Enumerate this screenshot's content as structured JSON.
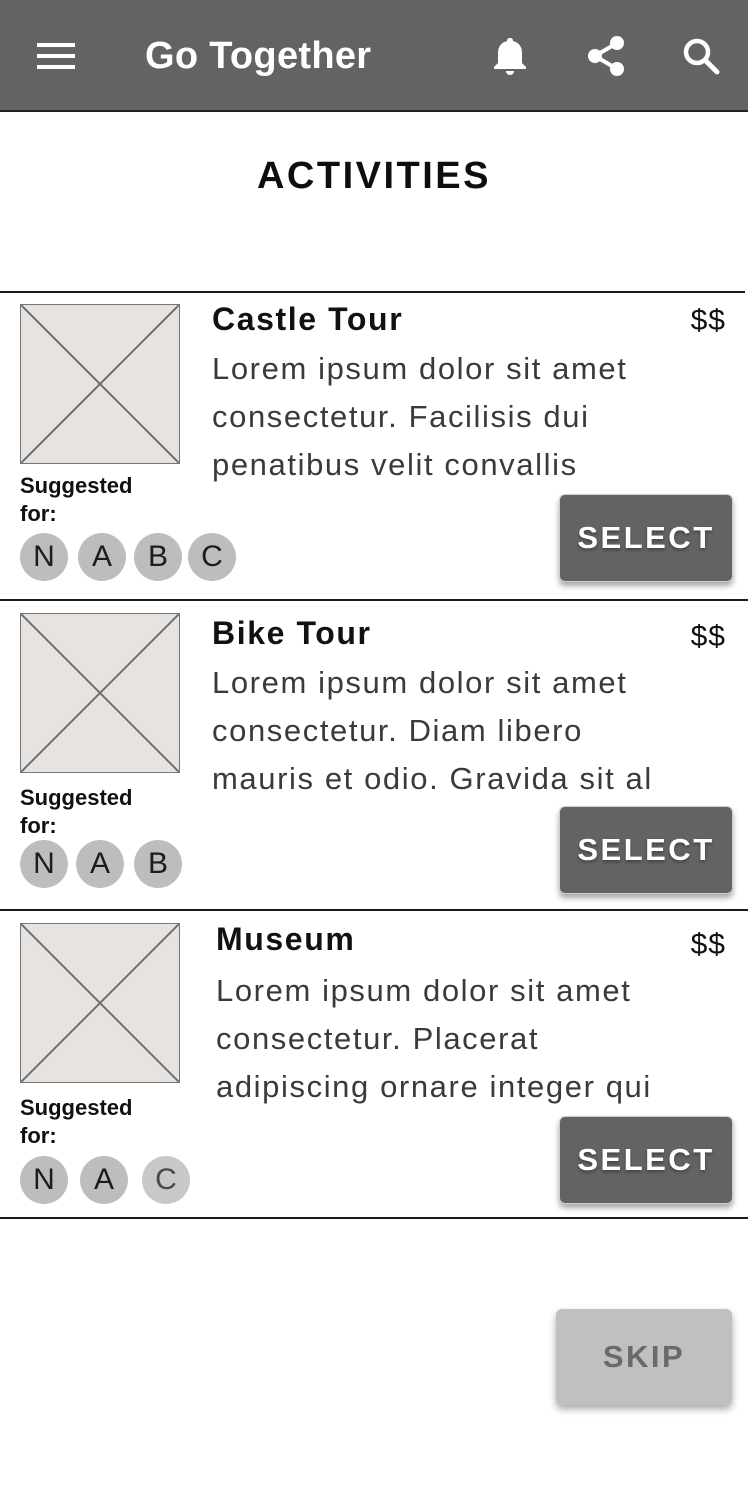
{
  "app_bar": {
    "title": "Go Together",
    "icons": [
      "menu-icon",
      "bell-icon",
      "share-icon",
      "search-icon"
    ],
    "background": "#636363"
  },
  "page": {
    "title": "ACTIVITIES"
  },
  "activities": [
    {
      "name": "Castle Tour",
      "price": "$$",
      "description_lines": [
        "Lorem ipsum dolor sit amet",
        "consectetur. Facilisis dui",
        "penatibus velit convallis"
      ],
      "suggested_label": "Suggested for:",
      "suggested_for": [
        "N",
        "A",
        "B",
        "C"
      ],
      "select_label": "SELECT"
    },
    {
      "name": "Bike Tour",
      "price": "$$",
      "description_lines": [
        "Lorem ipsum dolor sit amet",
        "consectetur. Diam libero",
        "mauris et odio. Gravida sit al"
      ],
      "suggested_label": "Suggested for:",
      "suggested_for": [
        "N",
        "A",
        "B"
      ],
      "select_label": "SELECT"
    },
    {
      "name": "Museum",
      "price": "$$",
      "description_lines": [
        "Lorem ipsum dolor sit amet",
        "consectetur. Placerat",
        "adipiscing ornare integer qui"
      ],
      "suggested_label": "Suggested for:",
      "suggested_for": [
        "N",
        "A",
        "C"
      ],
      "select_label": "SELECT"
    }
  ],
  "footer": {
    "skip_label": "SKIP"
  },
  "colors": {
    "primary_button": "#636363",
    "disabled_button": "#c0c0c0",
    "avatar": "#bdbdbd",
    "placeholder": "#e6e3e1"
  }
}
